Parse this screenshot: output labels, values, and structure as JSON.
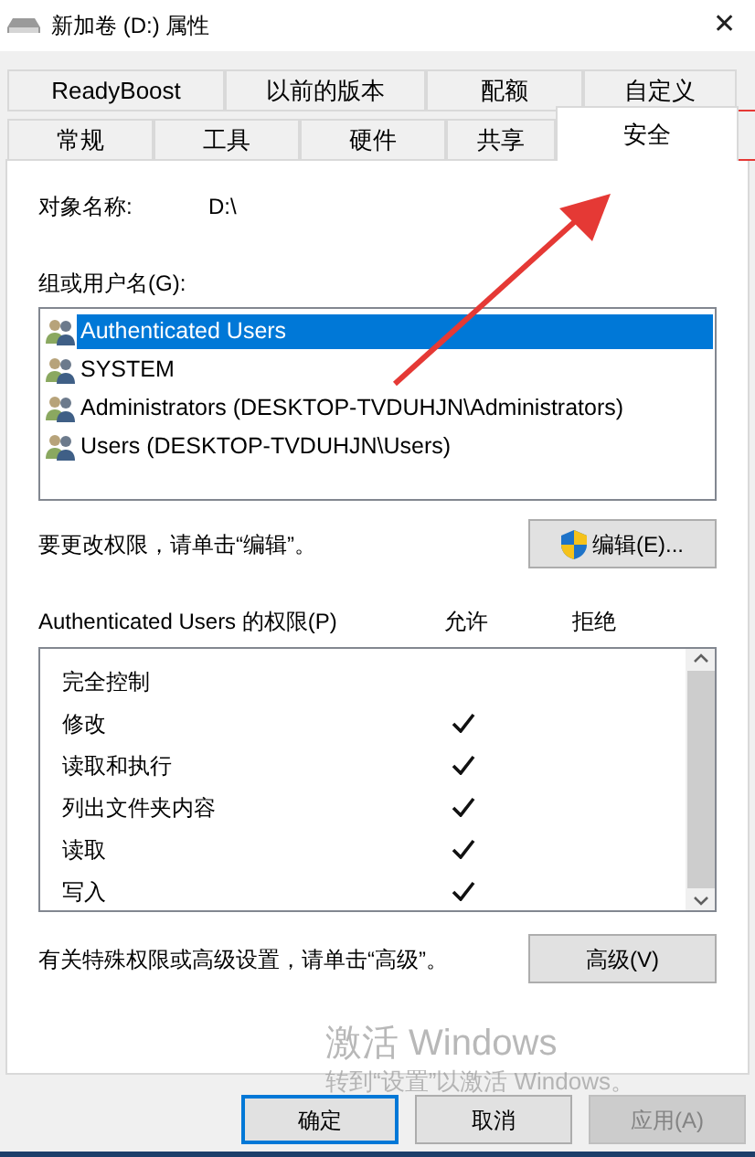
{
  "window": {
    "title": "新加卷 (D:) 属性",
    "close": "✕"
  },
  "tab_rows": [
    {
      "tabs": [
        {
          "label": "ReadyBoost",
          "selected": false
        },
        {
          "label": "以前的版本",
          "selected": false
        },
        {
          "label": "配额",
          "selected": false
        },
        {
          "label": "自定义",
          "selected": false
        }
      ]
    },
    {
      "tabs": [
        {
          "label": "常规",
          "selected": false
        },
        {
          "label": "工具",
          "selected": false
        },
        {
          "label": "硬件",
          "selected": false
        },
        {
          "label": "共享",
          "selected": false
        },
        {
          "label": "安全",
          "selected": true
        }
      ]
    }
  ],
  "object_name": {
    "label": "对象名称:",
    "value": "D:\\"
  },
  "groups": {
    "label": "组或用户名(G):",
    "items": [
      {
        "name": "Authenticated Users",
        "selected": true
      },
      {
        "name": "SYSTEM",
        "selected": false
      },
      {
        "name": "Administrators (DESKTOP-TVDUHJN\\Administrators)",
        "selected": false
      },
      {
        "name": "Users (DESKTOP-TVDUHJN\\Users)",
        "selected": false
      }
    ]
  },
  "edit_hint": "要更改权限，请单击“编辑”。",
  "edit_button": "编辑(E)...",
  "permissions": {
    "label": "Authenticated Users 的权限(P)",
    "allow_header": "允许",
    "deny_header": "拒绝",
    "rows": [
      {
        "name": "完全控制",
        "allow": false,
        "deny": false
      },
      {
        "name": "修改",
        "allow": true,
        "deny": false
      },
      {
        "name": "读取和执行",
        "allow": true,
        "deny": false
      },
      {
        "name": "列出文件夹内容",
        "allow": true,
        "deny": false
      },
      {
        "name": "读取",
        "allow": true,
        "deny": false
      },
      {
        "name": "写入",
        "allow": true,
        "deny": false
      }
    ]
  },
  "advanced_hint": "有关特殊权限或高级设置，请单击“高级”。",
  "advanced_button": "高级(V)",
  "buttons": [
    {
      "label": "确定",
      "focused": true,
      "disabled": false
    },
    {
      "label": "取消",
      "focused": false,
      "disabled": false
    },
    {
      "label": "应用(A)",
      "focused": false,
      "disabled": true
    }
  ],
  "activation_notice": {
    "title": "激活 Windows",
    "subtitle": "转到“设置”以激活 Windows。"
  }
}
